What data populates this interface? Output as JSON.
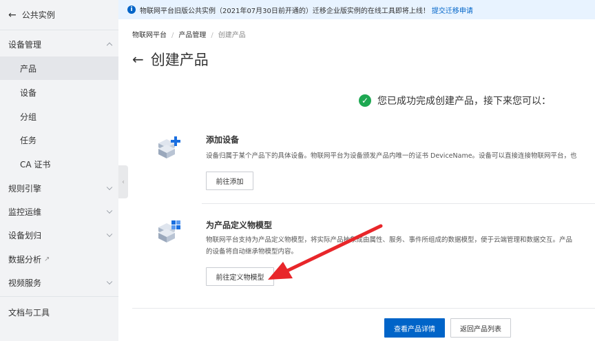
{
  "sidebar": {
    "back_label": "公共实例",
    "items": [
      {
        "label": "设备管理"
      },
      {
        "label": "产品"
      },
      {
        "label": "设备"
      },
      {
        "label": "分组"
      },
      {
        "label": "任务"
      },
      {
        "label": "CA 证书"
      },
      {
        "label": "规则引擎"
      },
      {
        "label": "监控运维"
      },
      {
        "label": "设备划归"
      },
      {
        "label": "数据分析"
      },
      {
        "label": "视频服务"
      },
      {
        "label": "文档与工具"
      }
    ],
    "external_link_glyph": "↗"
  },
  "banner": {
    "text": "物联网平台旧版公共实例（2021年07月30日前开通的）迁移企业版实例的在线工具即将上线！",
    "link": "提交迁移申请"
  },
  "breadcrumb": [
    "物联网平台",
    "产品管理",
    "创建产品"
  ],
  "page": {
    "back_glyph": "←",
    "title": "创建产品",
    "success_message": "您已成功完成创建产品，接下来您可以："
  },
  "steps": [
    {
      "title": "添加设备",
      "description": [
        "设备归属于某个产品下的具体设备。物联网平台为设备颁发产品内唯一的证书 DeviceName。设备可以直接连接物联网平台，也"
      ],
      "button": "前往添加",
      "icon": "add-device-icon"
    },
    {
      "title": "为产品定义物模型",
      "description": [
        "物联网平台支持为产品定义物模型，将实际产品抽象成由属性、服务、事件所组成的数据模型，便于云端管理和数据交互。产品",
        "的设备将自动继承物模型内容。"
      ],
      "button": "前往定义物模型",
      "icon": "thing-model-icon"
    }
  ],
  "footer": {
    "primary_button": "查看产品详情",
    "secondary_button": "返回产品列表"
  },
  "colors": {
    "primary": "#0064c8",
    "success": "#1ea852",
    "annotation_arrow": "#e8262a"
  }
}
